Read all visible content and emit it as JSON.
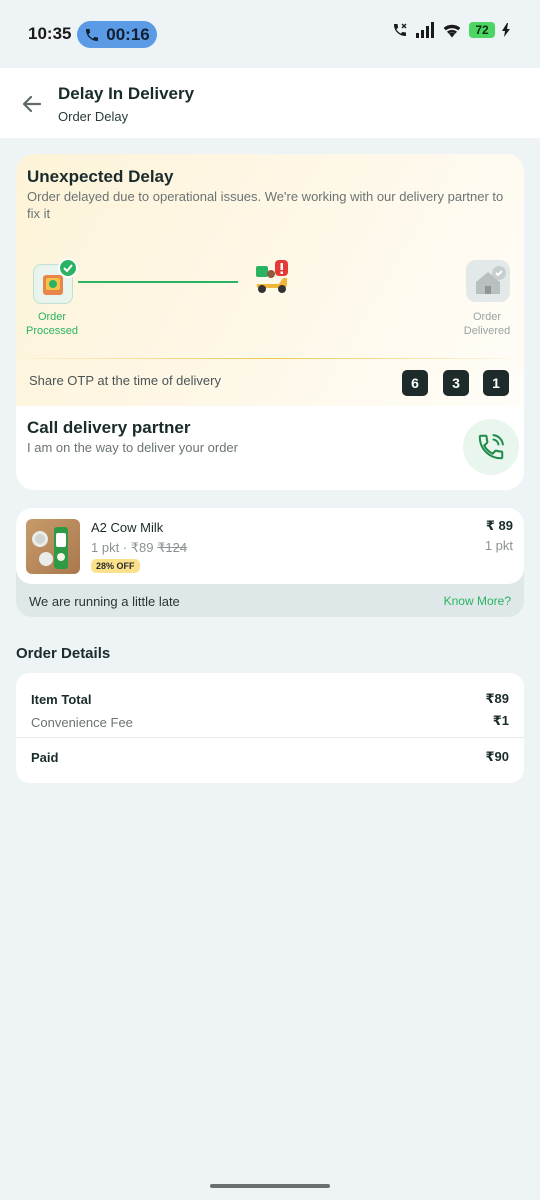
{
  "status_bar": {
    "time": "10:35",
    "call_duration": "00:16",
    "battery": "72"
  },
  "header": {
    "title": "Delay In Delivery",
    "subtitle": "Order Delay"
  },
  "delay": {
    "title": "Unexpected Delay",
    "description": "Order delayed due to operational issues. We're working with our delivery partner to fix it",
    "step_processed": "Order Processed",
    "step_delivered": "Order Delivered",
    "otp_label": "Share OTP at the time of delivery",
    "otp_digits": [
      "6",
      "3",
      "1"
    ]
  },
  "call_partner": {
    "title": "Call delivery partner",
    "subtitle": "I am on the way to deliver your order"
  },
  "product": {
    "name": "A2 Cow Milk",
    "quantity": "1 pkt",
    "price": "₹89",
    "mrp": "₹124",
    "discount": "28% OFF",
    "line_price": "₹ 89",
    "line_qty": "1 pkt",
    "late_message": "We are running a little late",
    "know_more": "Know More?"
  },
  "order_details": {
    "title": "Order Details",
    "item_total_label": "Item Total",
    "item_total_value": "₹89",
    "fee_label": "Convenience Fee",
    "fee_value": "₹1",
    "paid_label": "Paid",
    "paid_value": "₹90"
  },
  "colors": {
    "accent_green": "#2ab363",
    "background": "#eef3f5",
    "call_pill": "#5b9be6",
    "badge_yellow": "#fbe28a"
  }
}
